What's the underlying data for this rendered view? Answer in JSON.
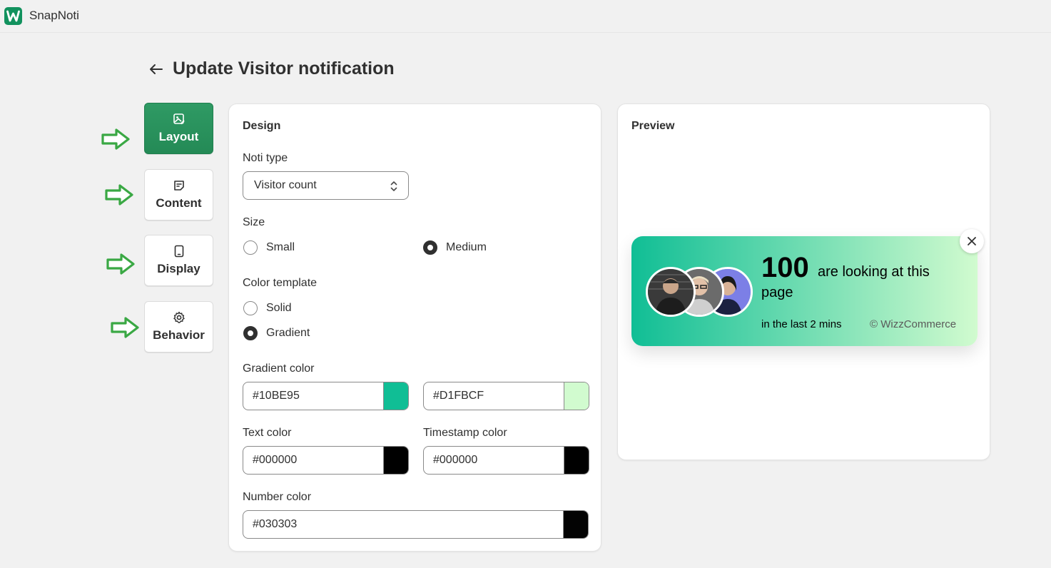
{
  "app": {
    "name": "SnapNoti",
    "icon": "w-logo-icon"
  },
  "page": {
    "title": "Update Visitor notification",
    "back_icon": "arrow-left-icon"
  },
  "tabs": [
    {
      "label": "Layout",
      "icon": "image-edit-icon",
      "active": true
    },
    {
      "label": "Content",
      "icon": "note-icon",
      "active": false
    },
    {
      "label": "Display",
      "icon": "tablet-icon",
      "active": false
    },
    {
      "label": "Behavior",
      "icon": "gear-icon",
      "active": false
    }
  ],
  "design": {
    "title": "Design",
    "noti_type": {
      "label": "Noti type",
      "value": "Visitor count"
    },
    "size": {
      "label": "Size",
      "options": [
        "Small",
        "Medium"
      ],
      "selected": "Medium"
    },
    "color_template": {
      "label": "Color template",
      "options": [
        "Solid",
        "Gradient"
      ],
      "selected": "Gradient"
    },
    "gradient_color": {
      "label": "Gradient color",
      "start": "#10BE95",
      "end": "#D1FBCF"
    },
    "text_color": {
      "label": "Text color",
      "value": "#000000"
    },
    "timestamp_color": {
      "label": "Timestamp color",
      "value": "#000000"
    },
    "number_color": {
      "label": "Number color",
      "value": "#030303"
    }
  },
  "preview": {
    "title": "Preview",
    "number": "100",
    "text_line1": "are looking at this",
    "text_line2": "page",
    "timestamp": "in the last 2 mins",
    "brand": "© WizzCommerce",
    "close_icon": "close-icon"
  },
  "colors": {
    "accent": "#248a56",
    "arrow": "#3aa844"
  }
}
